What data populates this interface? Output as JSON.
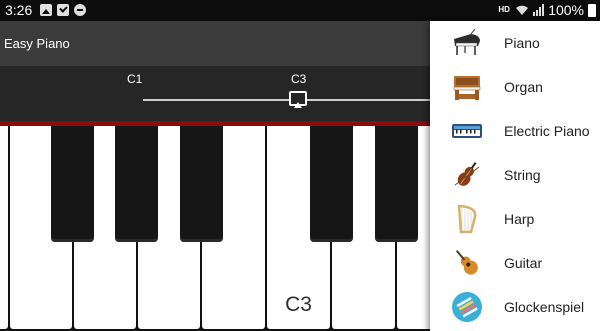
{
  "status_bar": {
    "time": "3:26",
    "hd_label": "HD",
    "battery_text": "100%"
  },
  "app": {
    "title": "Easy Piano"
  },
  "range": {
    "start_label": "C1",
    "current_label": "C3"
  },
  "keyboard": {
    "key_label": "C3"
  },
  "menu": {
    "items": [
      {
        "label": "Piano",
        "icon": "grand-piano-icon"
      },
      {
        "label": "Organ",
        "icon": "organ-icon"
      },
      {
        "label": "Electric Piano",
        "icon": "electric-piano-icon"
      },
      {
        "label": "String",
        "icon": "violin-icon"
      },
      {
        "label": "Harp",
        "icon": "harp-icon"
      },
      {
        "label": "Guitar",
        "icon": "guitar-icon"
      },
      {
        "label": "Glockenspiel",
        "icon": "glockenspiel-icon"
      }
    ]
  },
  "colors": {
    "app_bar": "#3b3b3b",
    "range_bar": "#262626",
    "accent_strip": "#8a0c0c",
    "menu_background": "#ffffff"
  }
}
